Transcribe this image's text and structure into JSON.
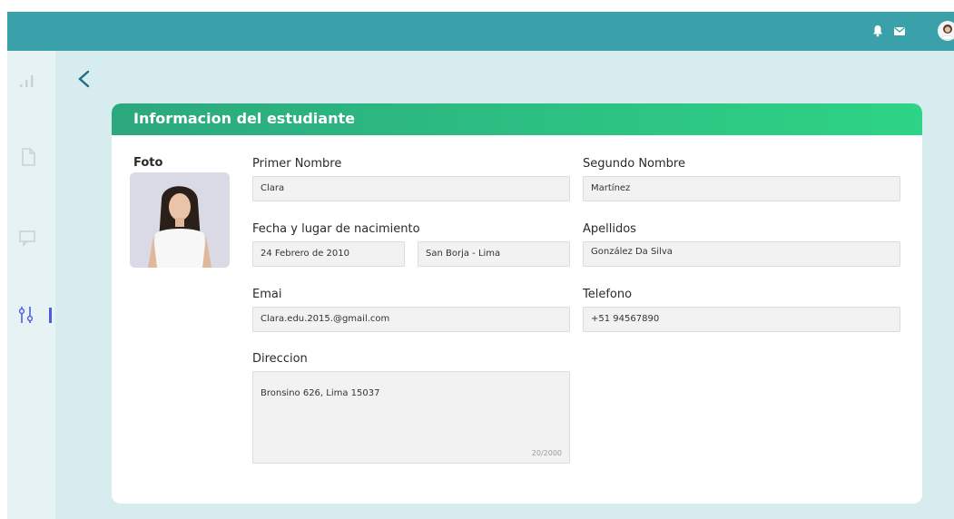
{
  "colors": {
    "topbar": "#3aa1ab",
    "background": "#d6ecef",
    "header_gradient_start": "#2ca87e",
    "header_gradient_end": "#2dd485",
    "active_icon": "#4a5de0"
  },
  "topbar": {
    "icons": [
      "bell-icon",
      "mail-icon",
      "avatar"
    ]
  },
  "sidebar": {
    "icons": [
      "bar-chart-icon",
      "document-icon",
      "chat-icon",
      "sliders-icon"
    ],
    "active": "sliders-icon"
  },
  "page": {
    "title": "Informacion del estudiante",
    "photo_label": "Foto",
    "fields": {
      "primer_nombre": {
        "label": "Primer Nombre",
        "value": "Clara"
      },
      "segundo_nombre": {
        "label": "Segundo Nombre",
        "value": "Martínez"
      },
      "nacimiento": {
        "label": "Fecha y lugar de nacimiento",
        "fecha": "24 Febrero de  2010",
        "lugar": "San Borja - Lima"
      },
      "apellidos": {
        "label": "Apellidos",
        "value": "González Da Silva"
      },
      "email": {
        "label": "Emai",
        "value": "Clara.edu.2015.@gmail.com"
      },
      "telefono": {
        "label": "Telefono",
        "value": "+51 94567890"
      },
      "direccion": {
        "label": "Direccion",
        "value": "Bronsino 626, Lima 15037",
        "counter": "20/2000"
      }
    }
  }
}
